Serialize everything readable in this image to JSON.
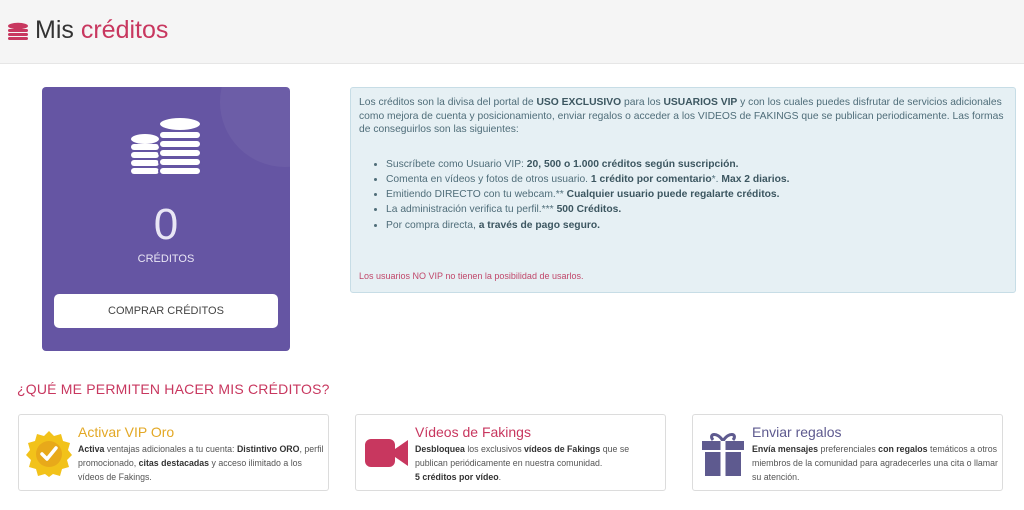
{
  "header": {
    "title_prefix": "Mis",
    "title_accent": "créditos"
  },
  "credits": {
    "count": "0",
    "label": "CRÉDITOS",
    "buy_label": "COMPRAR CRÉDITOS"
  },
  "info": {
    "intro": [
      {
        "t": "Los créditos son la divisa del portal de "
      },
      {
        "t": "USO EXCLUSIVO",
        "b": true
      },
      {
        "t": " para los "
      },
      {
        "t": "USUARIOS VIP",
        "b": true
      },
      {
        "t": " y con los cuales puedes disfrutar de servicios adicionales como mejora de cuenta y posicionamiento, enviar regalos o acceder a los VIDEOS de FAKINGS que se publican periodicamente. Las formas de conseguirlos son las siguientes:"
      }
    ],
    "items": [
      [
        {
          "t": "Suscríbete como Usuario VIP: "
        },
        {
          "t": "20, 500 o 1.000 créditos según suscripción.",
          "b": true
        }
      ],
      [
        {
          "t": "Comenta en vídeos y fotos de otros usuario. "
        },
        {
          "t": "1 crédito por comentario",
          "b": true
        },
        {
          "t": "*. "
        },
        {
          "t": "Max 2 diarios.",
          "b": true
        }
      ],
      [
        {
          "t": "Emitiendo DIRECTO con tu webcam.** "
        },
        {
          "t": "Cualquier usuario puede regalarte créditos.",
          "b": true
        }
      ],
      [
        {
          "t": "La administración verifica tu perfil.*** "
        },
        {
          "t": "500 Créditos.",
          "b": true
        }
      ],
      [
        {
          "t": "Por compra directa, "
        },
        {
          "t": "a través de pago seguro.",
          "b": true
        }
      ]
    ],
    "warning": "Los usuarios NO VIP no tienen la posibilidad de usarlos."
  },
  "section_title": "¿QUÉ ME PERMITEN HACER MIS CRÉDITOS?",
  "features": [
    {
      "title": "Activar VIP Oro",
      "title_color": "#e3a825",
      "icon": "gold-badge-icon",
      "desc": [
        {
          "t": "Activa",
          "b": true
        },
        {
          "t": " ventajas adicionales a tu cuenta: "
        },
        {
          "t": "Distintivo ORO",
          "b": true
        },
        {
          "t": ", perfil promocionado, "
        },
        {
          "t": "citas destacadas",
          "b": true
        },
        {
          "t": " y acceso ilimitado a los vídeos de Fakings."
        }
      ]
    },
    {
      "title": "Vídeos de Fakings",
      "title_color": "#c8375f",
      "icon": "video-camera-icon",
      "desc": [
        {
          "t": "Desbloquea",
          "b": true
        },
        {
          "t": " los exclusivos "
        },
        {
          "t": "vídeos de Fakings",
          "b": true
        },
        {
          "t": " que se publican periódicamente en nuestra comunidad."
        },
        {
          "br": true
        },
        {
          "t": "5 créditos por vídeo",
          "b": true
        },
        {
          "t": "."
        }
      ]
    },
    {
      "title": "Enviar regalos",
      "title_color": "#5e5a8f",
      "icon": "gift-icon",
      "desc": [
        {
          "t": "Envía mensajes",
          "b": true
        },
        {
          "t": " preferenciales "
        },
        {
          "t": "con regalos",
          "b": true
        },
        {
          "t": " temáticos a otros miembros de la comunidad para agradecerles una cita o llamar su atención."
        }
      ]
    }
  ],
  "colors": {
    "accent": "#c8375f",
    "card": "#6555a3",
    "gold": "#e3a825",
    "gift": "#5e5a8f",
    "info_bg": "#e6f0f4"
  }
}
